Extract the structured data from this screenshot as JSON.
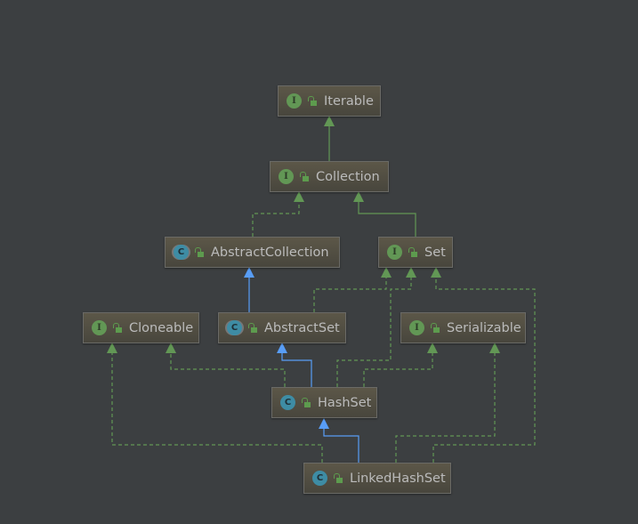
{
  "colors": {
    "background": "#3c3f41",
    "implements": "#629755",
    "extends_interface": "#629755",
    "extends_class": "#589df6",
    "text": "#bbbbbb"
  },
  "nodes": [
    {
      "id": "Iterable",
      "name": "Iterable",
      "kind": "interface"
    },
    {
      "id": "Collection",
      "name": "Collection",
      "kind": "interface"
    },
    {
      "id": "AbstractCollection",
      "name": "AbstractCollection",
      "kind": "abstract-class"
    },
    {
      "id": "Set",
      "name": "Set",
      "kind": "interface"
    },
    {
      "id": "Cloneable",
      "name": "Cloneable",
      "kind": "interface"
    },
    {
      "id": "AbstractSet",
      "name": "AbstractSet",
      "kind": "abstract-class"
    },
    {
      "id": "Serializable",
      "name": "Serializable",
      "kind": "interface"
    },
    {
      "id": "HashSet",
      "name": "HashSet",
      "kind": "class"
    },
    {
      "id": "LinkedHashSet",
      "name": "LinkedHashSet",
      "kind": "class"
    }
  ],
  "edges": [
    {
      "from": "Collection",
      "to": "Iterable",
      "type": "extends-interface"
    },
    {
      "from": "AbstractCollection",
      "to": "Collection",
      "type": "implements"
    },
    {
      "from": "Set",
      "to": "Collection",
      "type": "extends-interface"
    },
    {
      "from": "AbstractSet",
      "to": "AbstractCollection",
      "type": "extends-class"
    },
    {
      "from": "AbstractSet",
      "to": "Set",
      "type": "implements"
    },
    {
      "from": "HashSet",
      "to": "Set",
      "type": "implements"
    },
    {
      "from": "LinkedHashSet",
      "to": "Set",
      "type": "implements"
    },
    {
      "from": "HashSet",
      "to": "Cloneable",
      "type": "implements"
    },
    {
      "from": "LinkedHashSet",
      "to": "Cloneable",
      "type": "implements"
    },
    {
      "from": "HashSet",
      "to": "AbstractSet",
      "type": "extends-class"
    },
    {
      "from": "HashSet",
      "to": "Serializable",
      "type": "implements"
    },
    {
      "from": "LinkedHashSet",
      "to": "Serializable",
      "type": "implements"
    },
    {
      "from": "LinkedHashSet",
      "to": "HashSet",
      "type": "extends-class"
    }
  ]
}
